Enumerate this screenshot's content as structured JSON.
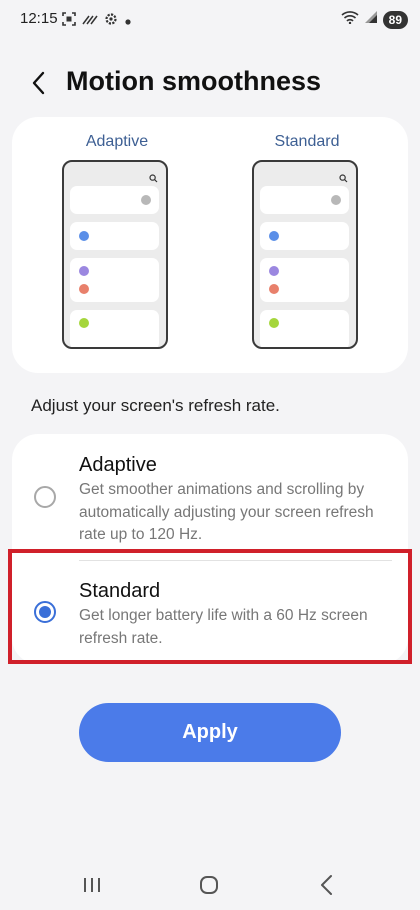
{
  "status_bar": {
    "time": "12:15",
    "battery": "89",
    "left_icons": [
      "screen-capture-icon",
      "missed-call-icon",
      "settings-gear-icon",
      "notification-dot-icon"
    ],
    "right_icons": [
      "wifi-icon",
      "signal-icon",
      "battery-icon"
    ]
  },
  "header": {
    "title": "Motion smoothness"
  },
  "preview": {
    "adaptive_label": "Adaptive",
    "standard_label": "Standard"
  },
  "subtitle": "Adjust your screen's refresh rate.",
  "options": [
    {
      "title": "Adaptive",
      "description": "Get smoother animations and scrolling by automatically adjusting your screen refresh rate up to 120 Hz.",
      "selected": false
    },
    {
      "title": "Standard",
      "description": "Get longer battery life with a 60 Hz screen refresh rate.",
      "selected": true
    }
  ],
  "apply_label": "Apply",
  "colors": {
    "accent": "#4b7be9",
    "radio_selected": "#3a6fd8",
    "highlight": "#d0202a",
    "dot_blue": "#5b8fe8",
    "dot_purple": "#9b87e0",
    "dot_coral": "#e8806b",
    "dot_green": "#a5d63c"
  },
  "nav": {
    "icons": [
      "recent-apps-icon",
      "home-icon",
      "back-icon"
    ]
  }
}
